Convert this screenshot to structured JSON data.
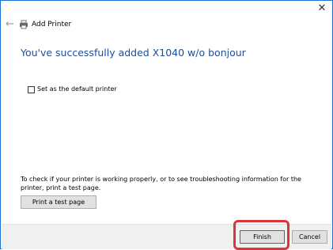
{
  "window": {
    "close_glyph": "✕",
    "accent_color": "#1874d2"
  },
  "nav": {
    "back_glyph": "←",
    "title": "Add Printer",
    "icon": "printer-icon"
  },
  "main": {
    "heading": "You've successfully added X1040 w/o bonjour",
    "default_printer_label": "Set as the default printer",
    "default_printer_checked": false,
    "info_text": "To check if your printer is working properly, or to see troubleshooting information for the printer, print a test page.",
    "test_page_label": "Print a test page"
  },
  "footer": {
    "finish_label": "Finish",
    "cancel_label": "Cancel",
    "highlight_color": "#d9363a"
  }
}
